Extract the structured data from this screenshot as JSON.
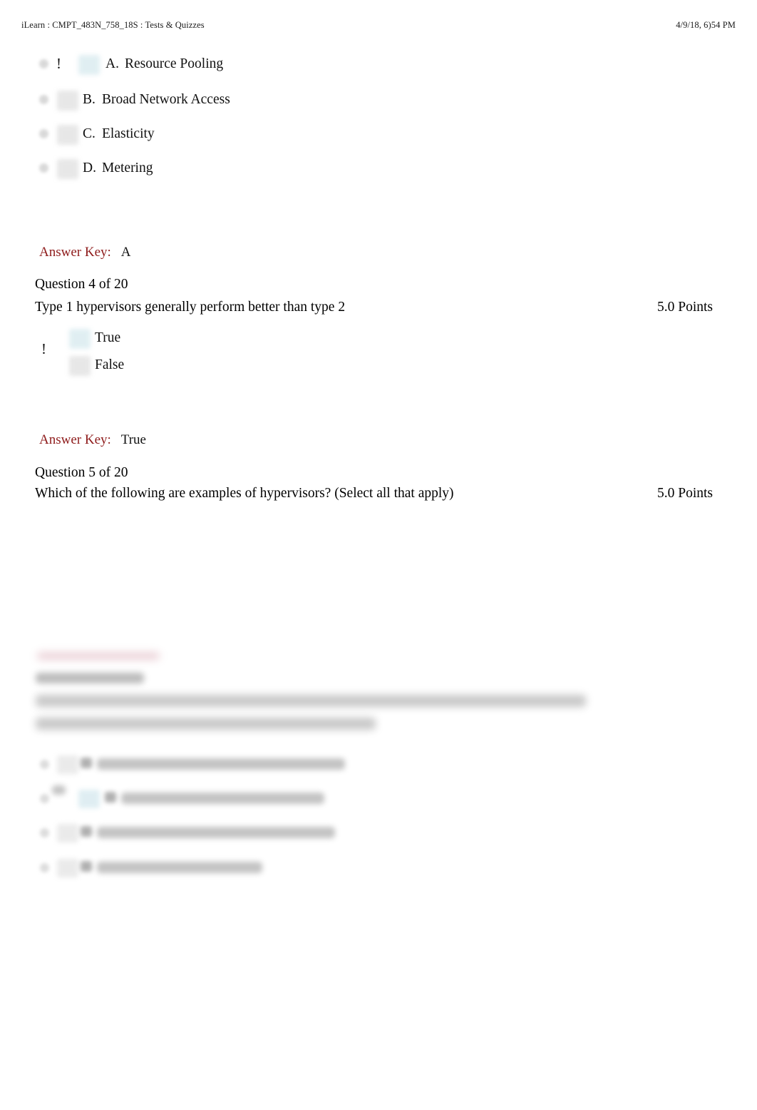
{
  "header": {
    "document_title": "iLearn : CMPT_483N_758_18S : Tests & Quizzes",
    "timestamp": "4/9/18, 6)54 PM"
  },
  "colors": {
    "answer_key_red": "#8e1b1b",
    "body_text": "#111111",
    "selected_highlight": "#dfeef2",
    "unselected_highlight": "#e3e3e3",
    "page_background": "#ffffff"
  },
  "questions": [
    {
      "id": "q3-options",
      "options": [
        {
          "letter": "A.",
          "label": "Resource Pooling",
          "marker": "!",
          "highlight": "blue"
        },
        {
          "letter": "B.",
          "label": "Broad Network Access",
          "marker": "",
          "highlight": "grey"
        },
        {
          "letter": "C.",
          "label": "Elasticity",
          "marker": "",
          "highlight": "grey"
        },
        {
          "letter": "D.",
          "label": "Metering",
          "marker": "",
          "highlight": "grey"
        }
      ],
      "answer_key": {
        "label": "Answer Key:",
        "value": "A"
      }
    },
    {
      "id": "q4",
      "meta": "Question 4 of 20",
      "text": "Type 1 hypervisors generally perform better than type 2",
      "points": "5.0 Points",
      "marker": "!",
      "options": [
        {
          "letter": "",
          "label": "True",
          "highlight": "blue"
        },
        {
          "letter": "",
          "label": "False",
          "highlight": "grey"
        }
      ],
      "answer_key": {
        "label": "Answer Key:",
        "value": "True"
      }
    },
    {
      "id": "q5",
      "meta": "Question 5 of 20",
      "text": "Which of the following are examples of hypervisors? (Select all that apply)",
      "points": "5.0 Points"
    }
  ],
  "blurred_section": {
    "note": "Illegible — rendered blurred in the source screenshot",
    "answer_key_line": "",
    "question_meta": "",
    "question_text_line_1": "",
    "question_text_line_2": "",
    "options": [
      "",
      "",
      "",
      ""
    ]
  }
}
